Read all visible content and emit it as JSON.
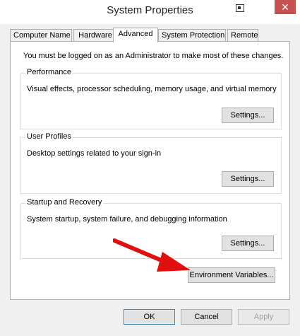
{
  "window": {
    "title": "System Properties",
    "close_glyph": "✕"
  },
  "tabs": [
    {
      "label": "Computer Name"
    },
    {
      "label": "Hardware"
    },
    {
      "label": "Advanced"
    },
    {
      "label": "System Protection"
    },
    {
      "label": "Remote"
    }
  ],
  "advanced": {
    "notice": "You must be logged on as an Administrator to make most of these changes.",
    "performance": {
      "title": "Performance",
      "description": "Visual effects, processor scheduling, memory usage, and virtual memory",
      "button": "Settings..."
    },
    "user_profiles": {
      "title": "User Profiles",
      "description": "Desktop settings related to your sign-in",
      "button": "Settings..."
    },
    "startup_recovery": {
      "title": "Startup and Recovery",
      "description": "System startup, system failure, and debugging information",
      "button": "Settings..."
    },
    "env_button": "Environment Variables..."
  },
  "footer": {
    "ok": "OK",
    "cancel": "Cancel",
    "apply": "Apply"
  },
  "colors": {
    "accent_arrow": "#e01010",
    "close": "#c75050",
    "focus": "#3c7fb1"
  },
  "icons": {
    "window": "window-icon",
    "close": "close-icon",
    "annotation": "red-arrow-icon"
  }
}
